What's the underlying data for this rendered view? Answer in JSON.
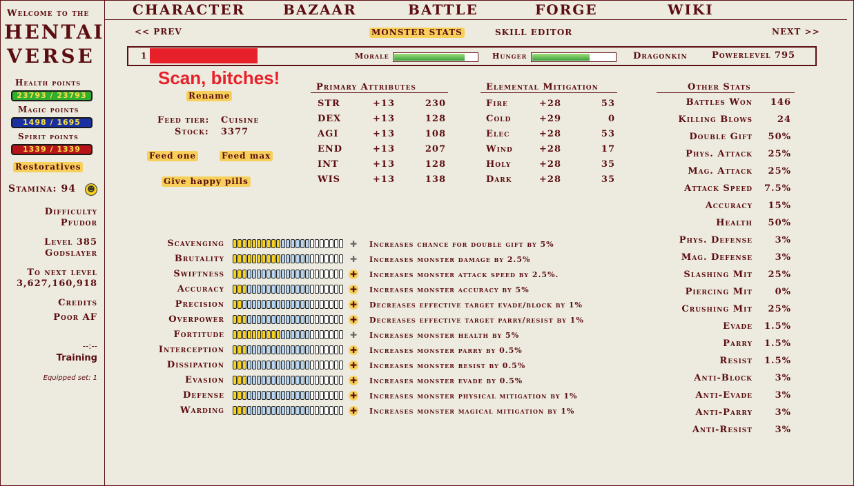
{
  "sidebar": {
    "welcome": "Welcome to the",
    "logo_line1": "HENTAI",
    "logo_line2": "VERSE",
    "hp_label": "Health points",
    "hp_value": "23793 / 23793",
    "mp_label": "Magic points",
    "mp_value": "1498 / 1695",
    "sp_label": "Spirit points",
    "sp_value": "1339 / 1339",
    "restoratives": "Restoratives",
    "stamina": "Stamina: 94",
    "difficulty_label": "Difficulty",
    "difficulty_value": "Pfudor",
    "level": "Level 385",
    "title": "Godslayer",
    "next_level_label": "To next level",
    "next_level_value": "3,627,160,918",
    "credits_label": "Credits",
    "credits_value": "Poor AF",
    "clock": "--:--",
    "training": "Training",
    "equipped_set": "Equipped set: 1"
  },
  "nav": {
    "character": "CHARACTER",
    "bazaar": "BAZAAR",
    "battle": "BATTLE",
    "forge": "FORGE",
    "wiki": "WIKI"
  },
  "subnav": {
    "prev": "<< PREV",
    "monster_stats": "MONSTER STATS",
    "skill_editor": "SKILL EDITOR",
    "next": "NEXT >>"
  },
  "monster": {
    "slot": "1",
    "name_redacted_color": "#e8202a",
    "morale_label": "Morale",
    "morale": 0.85,
    "hunger_label": "Hunger",
    "hunger": 0.69,
    "class": "Dragonkin",
    "powerlevel": "Powerlevel 795"
  },
  "scan_text": "Scan, bitches!",
  "rename": "Rename",
  "feed": {
    "tier_label": "Feed tier:",
    "tier_value": "Cuisine",
    "stock_label": "Stock:",
    "stock_value": "3377",
    "feed_one": "Feed one",
    "feed_max": "Feed max",
    "happy_pills": "Give happy pills"
  },
  "primary": {
    "title": "Primary Attributes",
    "rows": [
      {
        "name": "STR",
        "bonus": "+13",
        "value": "230"
      },
      {
        "name": "DEX",
        "bonus": "+13",
        "value": "128"
      },
      {
        "name": "AGI",
        "bonus": "+13",
        "value": "108"
      },
      {
        "name": "END",
        "bonus": "+13",
        "value": "207"
      },
      {
        "name": "INT",
        "bonus": "+13",
        "value": "128"
      },
      {
        "name": "WIS",
        "bonus": "+13",
        "value": "138"
      }
    ]
  },
  "elemental": {
    "title": "Elemental Mitigation",
    "rows": [
      {
        "name": "Fire",
        "bonus": "+28",
        "value": "53"
      },
      {
        "name": "Cold",
        "bonus": "+29",
        "value": "0"
      },
      {
        "name": "Elec",
        "bonus": "+28",
        "value": "53"
      },
      {
        "name": "Wind",
        "bonus": "+28",
        "value": "17"
      },
      {
        "name": "Holy",
        "bonus": "+28",
        "value": "35"
      },
      {
        "name": "Dark",
        "bonus": "+28",
        "value": "35"
      }
    ]
  },
  "other": {
    "title": "Other Stats",
    "rows": [
      {
        "name": "Battles Won",
        "value": "146"
      },
      {
        "name": "Killing Blows",
        "value": "24"
      },
      {
        "name": "Double Gift",
        "value": "50%"
      },
      {
        "name": "Phys. Attack",
        "value": "25%"
      },
      {
        "name": "Mag. Attack",
        "value": "25%"
      },
      {
        "name": "Attack Speed",
        "value": "7.5%"
      },
      {
        "name": "Accuracy",
        "value": "15%"
      },
      {
        "name": "Health",
        "value": "50%"
      },
      {
        "name": "Phys. Defense",
        "value": "3%"
      },
      {
        "name": "Mag. Defense",
        "value": "3%"
      },
      {
        "name": "Slashing Mit",
        "value": "25%"
      },
      {
        "name": "Piercing Mit",
        "value": "0%"
      },
      {
        "name": "Crushing Mit",
        "value": "25%"
      },
      {
        "name": "Evade",
        "value": "1.5%"
      },
      {
        "name": "Parry",
        "value": "1.5%"
      },
      {
        "name": "Resist",
        "value": "1.5%"
      },
      {
        "name": "Anti-Block",
        "value": "3%"
      },
      {
        "name": "Anti-Evade",
        "value": "3%"
      },
      {
        "name": "Anti-Parry",
        "value": "3%"
      },
      {
        "name": "Anti-Resist",
        "value": "3%"
      }
    ]
  },
  "skills": [
    {
      "name": "Scavenging",
      "level": 10,
      "max": 10,
      "can_add": false,
      "desc": "Increases chance for double gift by 5%"
    },
    {
      "name": "Brutality",
      "level": 10,
      "max": 10,
      "can_add": false,
      "desc": "Increases monster damage by 2.5%"
    },
    {
      "name": "Swiftness",
      "level": 3,
      "max": 10,
      "can_add": true,
      "desc": "Increases monster attack speed by 2.5%."
    },
    {
      "name": "Accuracy",
      "level": 3,
      "max": 10,
      "can_add": true,
      "desc": "Increases monster accuracy by 5%"
    },
    {
      "name": "Precision",
      "level": 2,
      "max": 10,
      "can_add": true,
      "desc": "Decreases effective target evade/block by 1%"
    },
    {
      "name": "Overpower",
      "level": 3,
      "max": 10,
      "can_add": true,
      "desc": "Decreases effective target parry/resist by 1%"
    },
    {
      "name": "Fortitude",
      "level": 10,
      "max": 10,
      "can_add": false,
      "desc": "Increases monster health by 5%"
    },
    {
      "name": "Interception",
      "level": 3,
      "max": 10,
      "can_add": true,
      "desc": "Increases monster parry by 0.5%"
    },
    {
      "name": "Dissipation",
      "level": 3,
      "max": 10,
      "can_add": true,
      "desc": "Increases monster resist by 0.5%"
    },
    {
      "name": "Evasion",
      "level": 3,
      "max": 10,
      "can_add": true,
      "desc": "Increases monster evade by 0.5%"
    },
    {
      "name": "Defense",
      "level": 3,
      "max": 10,
      "can_add": true,
      "desc": "Increases monster physical mitigation by 1%"
    },
    {
      "name": "Warding",
      "level": 3,
      "max": 10,
      "can_add": true,
      "desc": "Increases monster magical mitigation by 1%"
    }
  ],
  "colors": {
    "accent": "#5c0d11",
    "button": "#f6d05a",
    "hp": "#2fae2f",
    "mp": "#1a2fa0",
    "sp": "#b81418"
  }
}
